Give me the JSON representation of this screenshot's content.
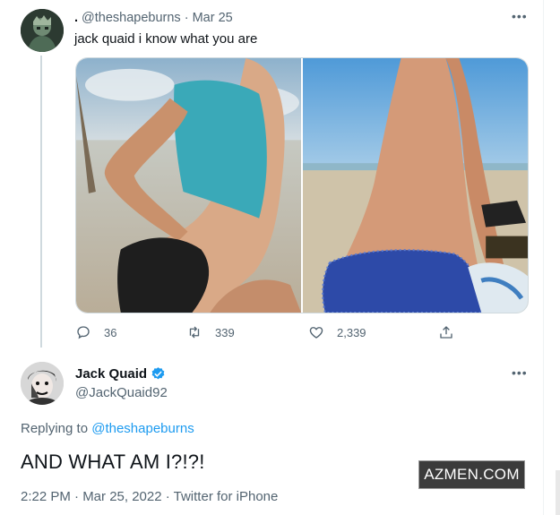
{
  "quoted_tweet": {
    "display_name": ".",
    "handle": "@theshapeburns",
    "date": "Mar 25",
    "separator": "·",
    "more_icon": "more-horizontal-icon",
    "text": "jack quaid i know what you are",
    "media": [
      {
        "icon": "photo-beach-man-teal-shirt"
      },
      {
        "icon": "photo-beach-shirtless-blue-shorts"
      }
    ],
    "stats": {
      "replies": "36",
      "retweets": "339",
      "likes": "2,339"
    }
  },
  "main_tweet": {
    "display_name": "Jack Quaid",
    "verified_icon": "verified-badge-icon",
    "handle": "@JackQuaid92",
    "more_icon": "more-horizontal-icon",
    "replying_prefix": "Replying to ",
    "replying_to": "@theshapeburns",
    "text": "AND WHAT AM I?!?!",
    "meta": "2:22 PM · Mar 25, 2022 · Twitter for iPhone"
  },
  "watermark": {
    "text": "AZMEN.COM"
  },
  "colors": {
    "link": "#1d9bf0",
    "secondary_text": "#536471",
    "primary_text": "#0f1419",
    "divider": "#cfd9de"
  }
}
